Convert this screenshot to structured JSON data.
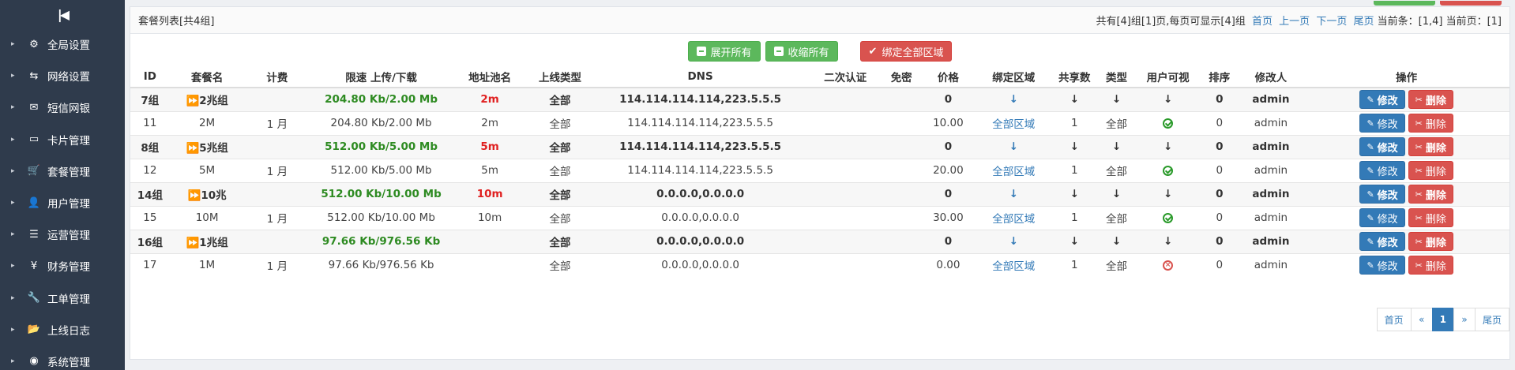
{
  "sidebar": {
    "toggle_icon": "collapse-icon",
    "items": [
      {
        "label": "全局设置",
        "icon": "gear-icon",
        "glyph": "⚙"
      },
      {
        "label": "网络设置",
        "icon": "network-icon",
        "glyph": "⇆"
      },
      {
        "label": "短信网银",
        "icon": "envelope-icon",
        "glyph": "✉"
      },
      {
        "label": "卡片管理",
        "icon": "card-icon",
        "glyph": "▭"
      },
      {
        "label": "套餐管理",
        "icon": "cart-icon",
        "glyph": "🛒"
      },
      {
        "label": "用户管理",
        "icon": "user-icon",
        "glyph": "👤"
      },
      {
        "label": "运营管理",
        "icon": "list-icon",
        "glyph": "☰"
      },
      {
        "label": "财务管理",
        "icon": "yen-icon",
        "glyph": "¥"
      },
      {
        "label": "工单管理",
        "icon": "wrench-icon",
        "glyph": "🔧"
      },
      {
        "label": "上线日志",
        "icon": "folder-icon",
        "glyph": "📂"
      },
      {
        "label": "系统管理",
        "icon": "globe-icon",
        "glyph": "◉"
      }
    ]
  },
  "panel": {
    "title": "套餐列表[共4组]",
    "pager_text": "共有[4]组[1]页,每页可显示[4]组",
    "first": "首页",
    "prev": "上一页",
    "next": "下一页",
    "last": "尾页",
    "current_items": "当前条：[1,4] 当前页：[1]"
  },
  "toolbar": {
    "expand_all": "展开所有",
    "collapse_all": "收缩所有",
    "bind_all": "绑定全部区域"
  },
  "columns": [
    "ID",
    "套餐名",
    "计费",
    "限速 上传/下载",
    "地址池名",
    "上线类型",
    "DNS",
    "二次认证",
    "免密",
    "价格",
    "绑定区域",
    "共享数",
    "类型",
    "用户可视",
    "排序",
    "修改人",
    "操作"
  ],
  "rows": [
    {
      "kind": "grp",
      "id": "7组",
      "name": "⏩2兆组",
      "billing": "",
      "speed": "204.80 Kb/2.00 Mb",
      "pool": "2m",
      "online": "全部",
      "dns": "114.114.114.114,223.5.5.5",
      "auth2": "",
      "nopwd": "",
      "price": "0",
      "region": "↓",
      "share": "↓",
      "type": "↓",
      "visible": "↓",
      "sort": "0",
      "editor": "admin"
    },
    {
      "kind": "sub",
      "id": "11",
      "name": "2M",
      "billing": "1 月",
      "speed": "204.80 Kb/2.00 Mb",
      "pool": "2m",
      "online": "全部",
      "dns": "114.114.114.114,223.5.5.5",
      "auth2": "",
      "nopwd": "",
      "price": "10.00",
      "region": "全部区域",
      "share": "1",
      "type": "全部",
      "visible": "ok",
      "sort": "0",
      "editor": "admin"
    },
    {
      "kind": "grp",
      "id": "8组",
      "name": "⏩5兆组",
      "billing": "",
      "speed": "512.00 Kb/5.00 Mb",
      "pool": "5m",
      "online": "全部",
      "dns": "114.114.114.114,223.5.5.5",
      "auth2": "",
      "nopwd": "",
      "price": "0",
      "region": "↓",
      "share": "↓",
      "type": "↓",
      "visible": "↓",
      "sort": "0",
      "editor": "admin"
    },
    {
      "kind": "sub",
      "id": "12",
      "name": "5M",
      "billing": "1 月",
      "speed": "512.00 Kb/5.00 Mb",
      "pool": "5m",
      "online": "全部",
      "dns": "114.114.114.114,223.5.5.5",
      "auth2": "",
      "nopwd": "",
      "price": "20.00",
      "region": "全部区域",
      "share": "1",
      "type": "全部",
      "visible": "ok",
      "sort": "0",
      "editor": "admin"
    },
    {
      "kind": "grp",
      "id": "14组",
      "name": "⏩10兆",
      "billing": "",
      "speed": "512.00 Kb/10.00 Mb",
      "pool": "10m",
      "online": "全部",
      "dns": "0.0.0.0,0.0.0.0",
      "auth2": "",
      "nopwd": "",
      "price": "0",
      "region": "↓",
      "share": "↓",
      "type": "↓",
      "visible": "↓",
      "sort": "0",
      "editor": "admin"
    },
    {
      "kind": "sub",
      "id": "15",
      "name": "10M",
      "billing": "1 月",
      "speed": "512.00 Kb/10.00 Mb",
      "pool": "10m",
      "online": "全部",
      "dns": "0.0.0.0,0.0.0.0",
      "auth2": "",
      "nopwd": "",
      "price": "30.00",
      "region": "全部区域",
      "share": "1",
      "type": "全部",
      "visible": "ok",
      "sort": "0",
      "editor": "admin"
    },
    {
      "kind": "grp",
      "id": "16组",
      "name": "⏩1兆组",
      "billing": "",
      "speed": "97.66 Kb/976.56 Kb",
      "pool": "",
      "online": "全部",
      "dns": "0.0.0.0,0.0.0.0",
      "auth2": "",
      "nopwd": "",
      "price": "0",
      "region": "↓",
      "share": "↓",
      "type": "↓",
      "visible": "↓",
      "sort": "0",
      "editor": "admin"
    },
    {
      "kind": "sub",
      "id": "17",
      "name": "1M",
      "billing": "1 月",
      "speed": "97.66 Kb/976.56 Kb",
      "pool": "",
      "online": "全部",
      "dns": "0.0.0.0,0.0.0.0",
      "auth2": "",
      "nopwd": "",
      "price": "0.00",
      "region": "全部区域",
      "share": "1",
      "type": "全部",
      "visible": "bad",
      "sort": "0",
      "editor": "admin"
    }
  ],
  "actions": {
    "edit": "修改",
    "delete": "删除"
  },
  "pagination": {
    "first": "首页",
    "prev": "«",
    "current": "1",
    "next": "»",
    "last": "尾页"
  },
  "colors": {
    "sidebar_bg": "#2f3b4c",
    "green": "#5cb85c",
    "red": "#d9534f",
    "blue": "#337ab7"
  }
}
